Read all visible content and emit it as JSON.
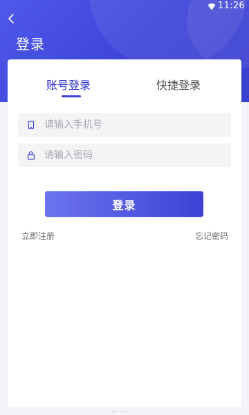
{
  "status_bar": {
    "time": "11:26",
    "wifi_icon": "wifi-icon"
  },
  "header": {
    "title": "登录",
    "back_icon": "back-arrow-icon",
    "accent_color": "#3d43d8"
  },
  "tabs": [
    {
      "label": "账号登录",
      "active": true
    },
    {
      "label": "快捷登录",
      "active": false
    }
  ],
  "form": {
    "phone": {
      "placeholder": "请输入手机号",
      "value": "",
      "icon": "phone-icon"
    },
    "password": {
      "placeholder": "请输入密码",
      "value": "",
      "icon": "lock-icon"
    },
    "login_label": "登录"
  },
  "links": {
    "register": "立即注册",
    "forgot_password": "忘记密码"
  }
}
